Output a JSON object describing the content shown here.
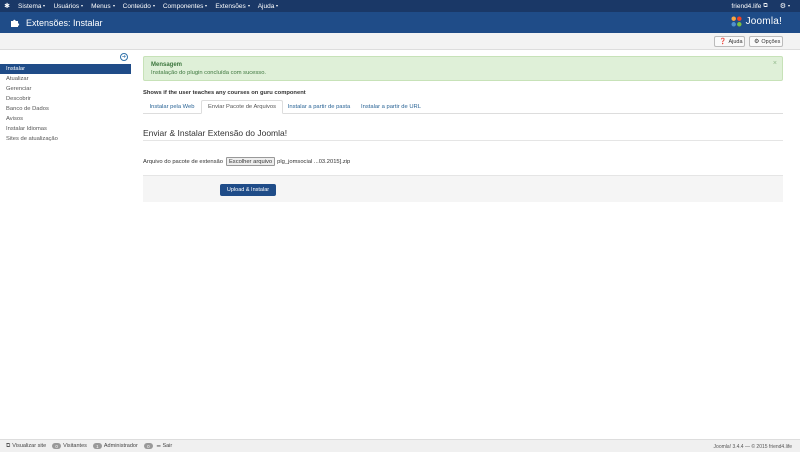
{
  "navbar": {
    "menu": [
      {
        "label": "Sistema"
      },
      {
        "label": "Usuários"
      },
      {
        "label": "Menus"
      },
      {
        "label": "Conteúdo"
      },
      {
        "label": "Componentes"
      },
      {
        "label": "Extensões"
      },
      {
        "label": "Ajuda"
      }
    ],
    "site_label": "friend4.life"
  },
  "header": {
    "title": "Extensões: Instalar",
    "logo_text": "Joomla!"
  },
  "toolbar": {
    "help_label": "Ajuda",
    "options_label": "Opções"
  },
  "sidebar": {
    "items": [
      {
        "label": "Instalar"
      },
      {
        "label": "Atualizar"
      },
      {
        "label": "Gerenciar"
      },
      {
        "label": "Descobrir"
      },
      {
        "label": "Banco de Dados"
      },
      {
        "label": "Avisos"
      },
      {
        "label": "Instalar Idiomas"
      },
      {
        "label": "Sites de atualização"
      }
    ]
  },
  "alert": {
    "heading": "Mensagem",
    "message": "Instalação do plugin concluída com sucesso.",
    "close": "×"
  },
  "notice": "Shows if the user teaches any courses on guru component",
  "tabs": [
    {
      "label": "Instalar pela Web"
    },
    {
      "label": "Enviar Pacote de Arquivos"
    },
    {
      "label": "Instalar a partir de pasta"
    },
    {
      "label": "Instalar a partir de URL"
    }
  ],
  "upload": {
    "section_title": "Enviar & Instalar Extensão do Joomla!",
    "file_label": "Arquivo do pacote de extensão",
    "choose_button": "Escolher arquivo",
    "file_name": "plg_jomsocial ...03.2015].zip",
    "submit_label": "Upload & Instalar"
  },
  "footer": {
    "view_site": "Visualizar site",
    "visitors_count": "0",
    "visitors_label": "Visitantes",
    "admin_count": "1",
    "admin_label": "Administrador",
    "messages_count": "0",
    "logout_label": "Sair",
    "version": "Joomla! 3.4.4 — © 2015 friend4.life"
  },
  "colors": {
    "navbar_bg": "#1a3867",
    "header_bg": "#1f4c88",
    "alert_bg": "#dff0d8",
    "link": "#2a6496"
  }
}
